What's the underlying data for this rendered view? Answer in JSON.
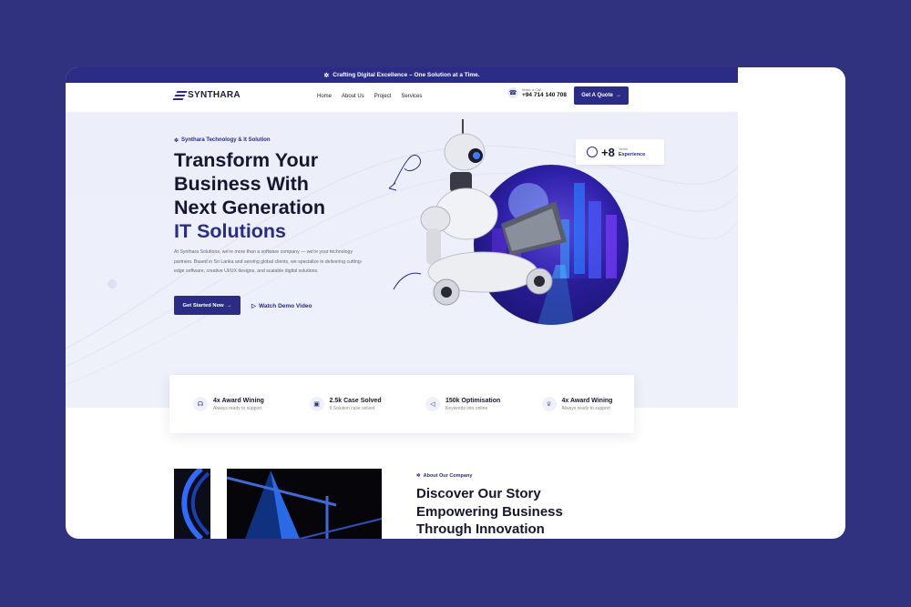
{
  "topbar": {
    "icon": "spark-icon",
    "text": "Crafting Digital Excellence – One Solution at a Time."
  },
  "brand": {
    "name": "SYNTHARA",
    "color": "#2a2c85"
  },
  "nav": {
    "items": [
      "Home",
      "About Us",
      "Project",
      "Services"
    ],
    "call_label": "Make a Call",
    "phone": "+94 714 140 708",
    "quote_button": "Get A Quote"
  },
  "hero": {
    "eyebrow": "Synthara Technology & It Solution",
    "title_line1": "Transform Your",
    "title_line2": "Business With",
    "title_line3": "Next Generation",
    "title_accent": "IT Solutions",
    "lead": "At Synthara Solutions, we're more than a software company — we're your technology partners. Based in Sri Lanka and serving global clients, we specialize in delivering cutting-edge software, creative UI/UX designs, and scalable digital solutions.",
    "primary_button": "Get Started Now",
    "secondary_button": "Watch Demo Video",
    "experience": {
      "value": "+8",
      "small": "Years",
      "label": "Experience"
    }
  },
  "stats": [
    {
      "icon": "award-icon",
      "title": "4x Award Wining",
      "sub": "Always ready to support"
    },
    {
      "icon": "briefcase-icon",
      "title": "2.5k Case Solved",
      "sub": "It Solution case solved"
    },
    {
      "icon": "megaphone-icon",
      "title": "150k Optimisation",
      "sub": "Keywords into online"
    },
    {
      "icon": "trophy-icon",
      "title": "4x Award Wining",
      "sub": "Always ready to support"
    }
  ],
  "about": {
    "eyebrow": "About Our Company",
    "title_line1": "Discover Our Story",
    "title_line2": "Empowering Business",
    "title_line3": "Through Innovation"
  },
  "colors": {
    "background": "#30327f",
    "accent": "#2a2c85",
    "hero_bg": "#eceefa"
  }
}
